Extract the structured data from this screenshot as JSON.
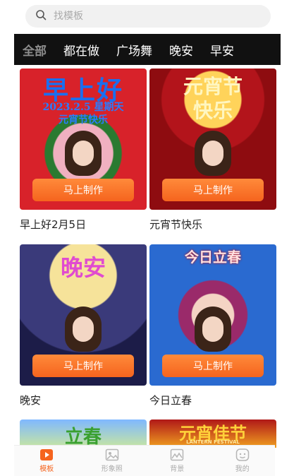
{
  "search": {
    "placeholder": "找模板"
  },
  "tabs": [
    "全部",
    "都在做",
    "广场舞",
    "晚安",
    "早安"
  ],
  "cards": [
    {
      "title": "早上好2月5日",
      "overlay_line1": "早上好",
      "overlay_line2": "2023.2.5 星期天",
      "overlay_line3": "元宵节快乐",
      "button": "马上制作"
    },
    {
      "title": "元宵节快乐",
      "overlay_line1": "元宵节",
      "overlay_line2": "快乐",
      "button": "马上制作"
    },
    {
      "title": "晚安",
      "overlay_line1": "晚安",
      "button": "马上制作"
    },
    {
      "title": "今日立春",
      "overlay_line1": "今日立春",
      "button": "马上制作"
    },
    {
      "overlay_line1": "立春"
    },
    {
      "overlay_line1": "元宵佳节",
      "overlay_line2": "LANTERN FESTIVAL"
    }
  ],
  "nav": {
    "items": [
      {
        "label": "模板",
        "icon": "play-icon"
      },
      {
        "label": "形象照",
        "icon": "image-icon"
      },
      {
        "label": "背景",
        "icon": "landscape-icon"
      },
      {
        "label": "我的",
        "icon": "smiley-icon"
      }
    ],
    "active_index": 0
  },
  "colors": {
    "accent": "#f5641e",
    "tab_bar": "#111111",
    "active_tab": "#8c8c8c"
  }
}
